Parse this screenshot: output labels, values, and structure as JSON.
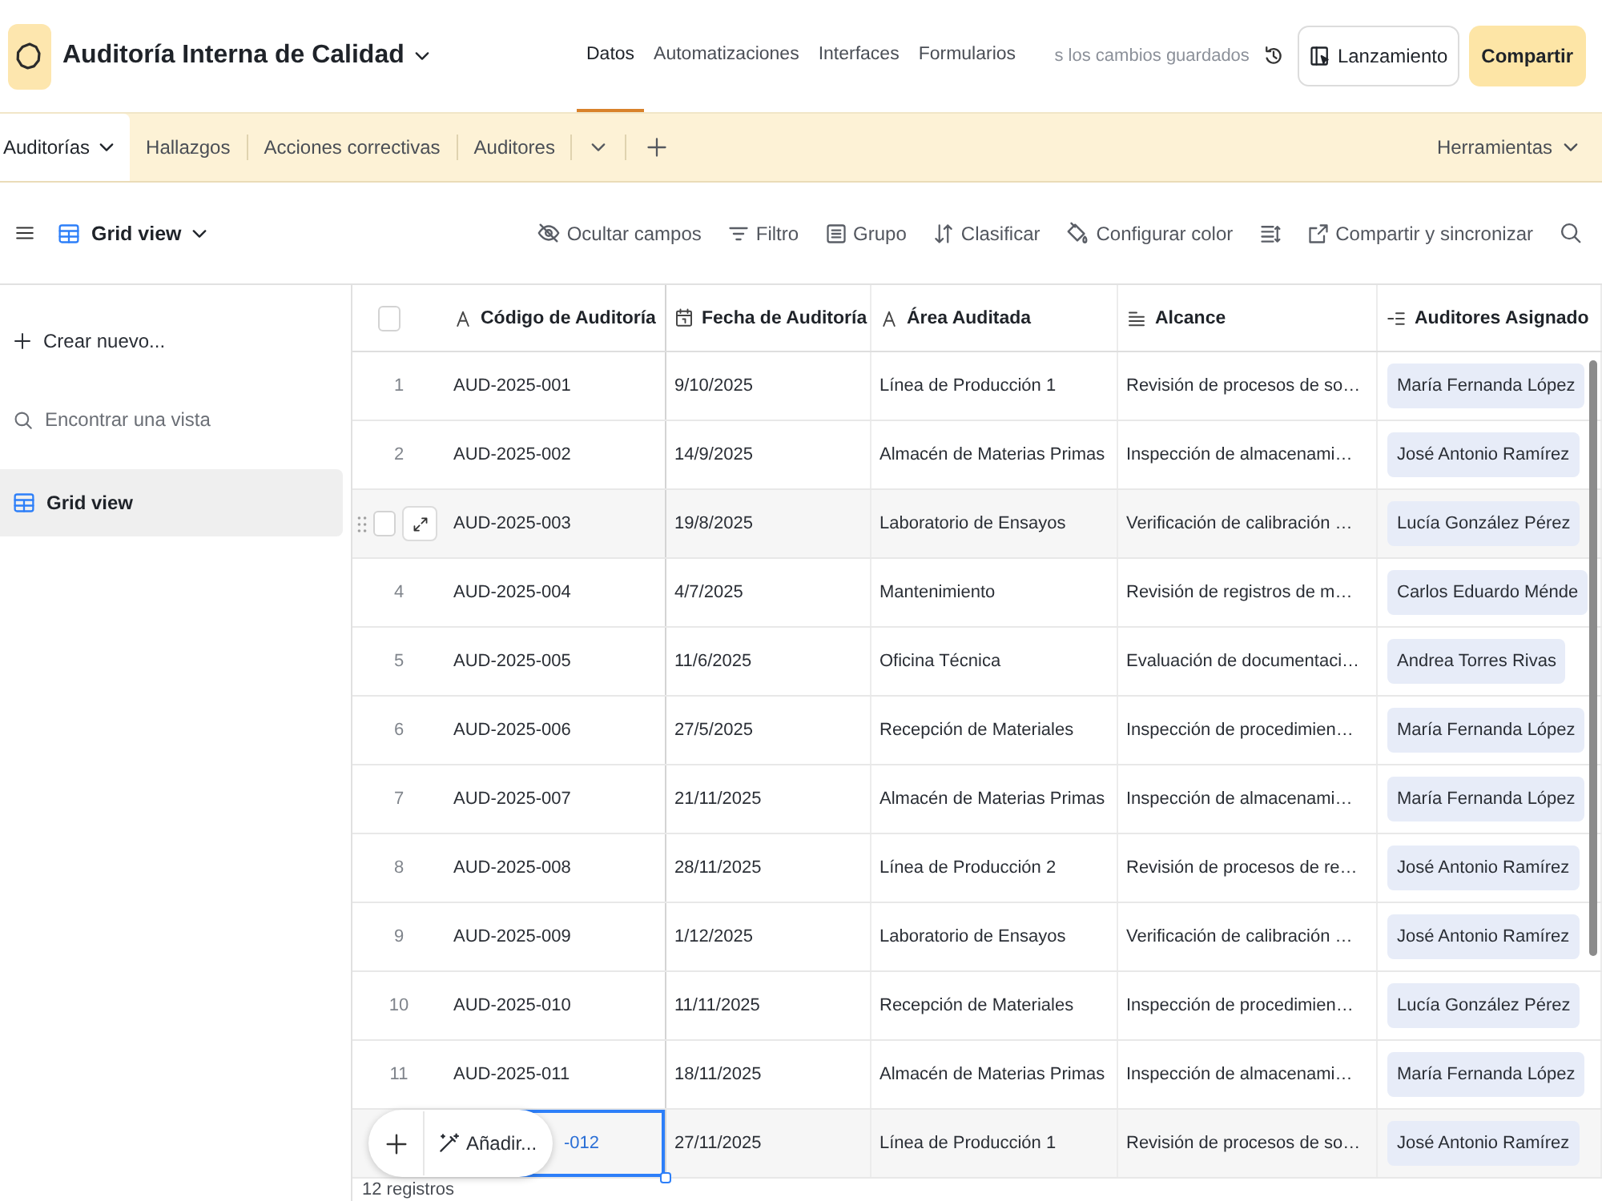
{
  "app_bar": {
    "title": "Auditoría Interna de Calidad",
    "nav": [
      {
        "label": "Datos",
        "selected": true
      },
      {
        "label": "Automatizaciones",
        "selected": false
      },
      {
        "label": "Interfaces",
        "selected": false
      },
      {
        "label": "Formularios",
        "selected": false
      }
    ],
    "save_status": "s los cambios guardados",
    "launch_button": "Lanzamiento",
    "share_button": "Compartir"
  },
  "table_tabs": {
    "tabs": [
      {
        "label": "Auditorías",
        "selected": true
      },
      {
        "label": "Hallazgos",
        "selected": false
      },
      {
        "label": "Acciones correctivas",
        "selected": false
      },
      {
        "label": "Auditores",
        "selected": false
      }
    ],
    "tools": "Herramientas"
  },
  "view_bar": {
    "view": "Grid view",
    "actions": [
      "Ocultar campos",
      "Filtro",
      "Grupo",
      "Clasificar",
      "Configurar color",
      "Compartir y sincronizar"
    ]
  },
  "sidebar": {
    "create": "Crear nuevo...",
    "search": {
      "placeholder": "Encontrar una vista"
    },
    "views": [
      {
        "label": "Grid view",
        "selected": true
      }
    ]
  },
  "grid": {
    "select_all": {
      "checked": false
    },
    "columns": [
      {
        "label": "Código de Auditoría",
        "kind": "text"
      },
      {
        "label": "Fecha de Auditoría",
        "kind": "date"
      },
      {
        "label": "Área Auditada",
        "kind": "text"
      },
      {
        "label": "Alcance",
        "kind": "long_text"
      },
      {
        "label": "Auditores Asignado",
        "kind": "multi_select"
      }
    ],
    "rows": [
      {
        "number": "1",
        "code": "AUD-2025-001",
        "date": "9/10/2025",
        "area": "Línea de Producción 1",
        "scope": "Revisión de procesos de so…",
        "auditors": [
          "María Fernanda López"
        ],
        "hovered": false,
        "checked": false,
        "selected": false
      },
      {
        "number": "2",
        "code": "AUD-2025-002",
        "date": "14/9/2025",
        "area": "Almacén de Materias Primas",
        "scope": "Inspección de almacenami…",
        "auditors": [
          "José Antonio Ramírez"
        ],
        "hovered": false,
        "checked": false,
        "selected": false
      },
      {
        "code": "AUD-2025-003",
        "date": "19/8/2025",
        "area": "Laboratorio de Ensayos",
        "scope": "Verificación de calibración …",
        "auditors": [
          "Lucía González Pérez"
        ],
        "hovered": true,
        "checked": false,
        "selected": false
      },
      {
        "number": "4",
        "code": "AUD-2025-004",
        "date": "4/7/2025",
        "area": "Mantenimiento",
        "scope": "Revisión de registros de m…",
        "auditors": [
          "Carlos Eduardo Ménde"
        ],
        "hovered": false,
        "checked": false,
        "selected": false
      },
      {
        "number": "5",
        "code": "AUD-2025-005",
        "date": "11/6/2025",
        "area": "Oficina Técnica",
        "scope": "Evaluación de documentaci…",
        "auditors": [
          "Andrea Torres Rivas"
        ],
        "hovered": false,
        "checked": false,
        "selected": false
      },
      {
        "number": "6",
        "code": "AUD-2025-006",
        "date": "27/5/2025",
        "area": "Recepción de Materiales",
        "scope": "Inspección de procedimien…",
        "auditors": [
          "María Fernanda López"
        ],
        "hovered": false,
        "checked": false,
        "selected": false
      },
      {
        "number": "7",
        "code": "AUD-2025-007",
        "date": "21/11/2025",
        "area": "Almacén de Materias Primas",
        "scope": "Inspección de almacenami…",
        "auditors": [
          "María Fernanda López"
        ],
        "hovered": false,
        "checked": false,
        "selected": false
      },
      {
        "number": "8",
        "code": "AUD-2025-008",
        "date": "28/11/2025",
        "area": "Línea de Producción 2",
        "scope": "Revisión de procesos de re…",
        "auditors": [
          "José Antonio Ramírez"
        ],
        "hovered": false,
        "checked": false,
        "selected": false
      },
      {
        "number": "9",
        "code": "AUD-2025-009",
        "date": "1/12/2025",
        "area": "Laboratorio de Ensayos",
        "scope": "Verificación de calibración …",
        "auditors": [
          "José Antonio Ramírez"
        ],
        "hovered": false,
        "checked": false,
        "selected": false
      },
      {
        "number": "10",
        "code": "AUD-2025-010",
        "date": "11/11/2025",
        "area": "Recepción de Materiales",
        "scope": "Inspección de procedimien…",
        "auditors": [
          "Lucía González Pérez"
        ],
        "hovered": false,
        "checked": false,
        "selected": false
      },
      {
        "number": "11",
        "code": "AUD-2025-011",
        "date": "18/11/2025",
        "area": "Almacén de Materias Primas",
        "scope": "Inspección de almacenami…",
        "auditors": [
          "María Fernanda López"
        ],
        "hovered": false,
        "checked": false,
        "selected": false
      },
      {
        "code": "-012",
        "date": "27/11/2025",
        "area": "Línea de Producción 1",
        "scope": "Revisión de procesos de so…",
        "auditors": [
          "José Antonio Ramírez"
        ],
        "hovered": false,
        "checked": false,
        "selected": true
      }
    ],
    "add_bar": {
      "label": "Añadir..."
    },
    "record_count": "12 registros"
  }
}
